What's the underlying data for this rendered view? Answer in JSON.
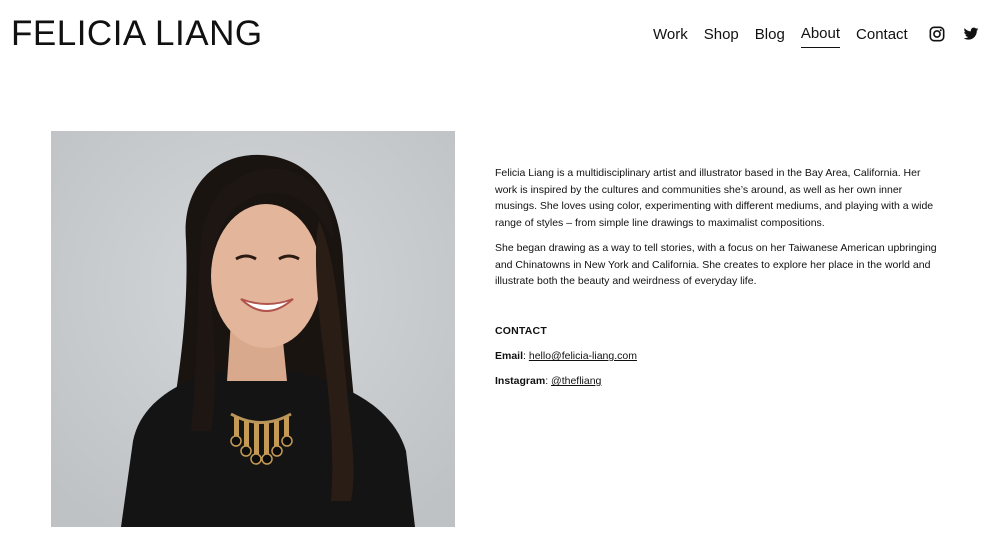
{
  "header": {
    "site_title": "FELICIA LIANG",
    "nav": [
      {
        "label": "Work",
        "active": false
      },
      {
        "label": "Shop",
        "active": false
      },
      {
        "label": "Blog",
        "active": false
      },
      {
        "label": "About",
        "active": true
      },
      {
        "label": "Contact",
        "active": false
      }
    ],
    "social": [
      {
        "icon": "instagram-icon"
      },
      {
        "icon": "twitter-icon"
      }
    ]
  },
  "main": {
    "photo": {
      "subject": "portrait of smiling woman in black shirt with gold necklace"
    },
    "bio": [
      "Felicia Liang is a multidisciplinary artist and illustrator based in the Bay Area, California. Her work is inspired by the cultures and communities she’s around, as well as her own inner musings. She loves using color, experimenting with different mediums, and playing with a wide range of styles – from simple line drawings to maximalist compositions.",
      "She began drawing as a way to tell stories, with a focus on her Taiwanese American upbringing and Chinatowns in New York and California. She creates to explore her place in the world and illustrate both the beauty and weirdness of everyday life."
    ],
    "contact": {
      "heading": "CONTACT",
      "email_label": "Email",
      "email_value": "hello@felicia-liang.com",
      "instagram_label": "Instagram",
      "instagram_value": "@thefliang",
      "separator": ":"
    }
  },
  "colors": {
    "text": "#111111",
    "background": "#ffffff",
    "photo_bg": "#c9cccf"
  }
}
